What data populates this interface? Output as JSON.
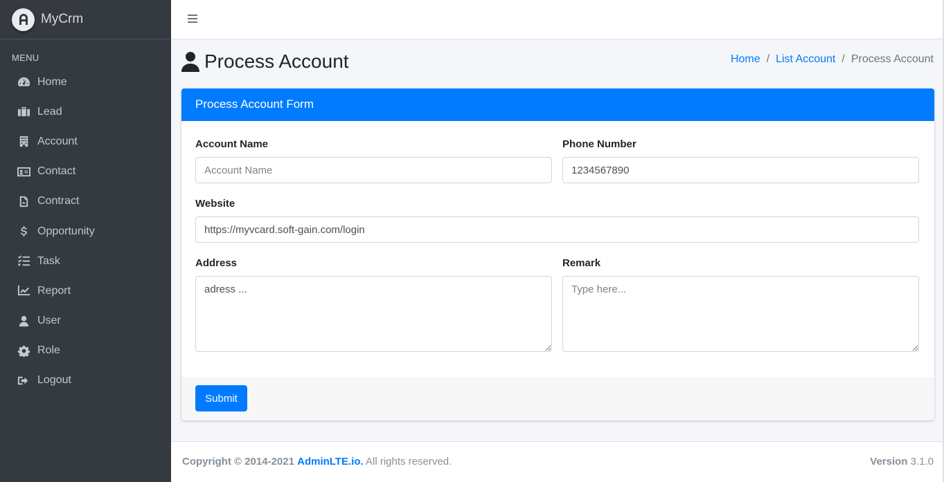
{
  "brand": {
    "name": "MyCrm",
    "logo_icon": "adminlte-logo-icon"
  },
  "sidebar": {
    "header": "MENU",
    "items": [
      {
        "label": "Home",
        "icon": "tachometer-icon"
      },
      {
        "label": "Lead",
        "icon": "briefcase-icon"
      },
      {
        "label": "Account",
        "icon": "building-icon"
      },
      {
        "label": "Contact",
        "icon": "address-card-icon"
      },
      {
        "label": "Contract",
        "icon": "file-contract-icon"
      },
      {
        "label": "Opportunity",
        "icon": "dollar-icon"
      },
      {
        "label": "Task",
        "icon": "tasks-icon"
      },
      {
        "label": "Report",
        "icon": "chart-line-icon"
      },
      {
        "label": "User",
        "icon": "user-icon"
      },
      {
        "label": "Role",
        "icon": "gear-icon"
      },
      {
        "label": "Logout",
        "icon": "sign-out-icon"
      }
    ]
  },
  "page": {
    "title": "Process Account",
    "breadcrumb": [
      "Home",
      "List Account",
      "Process Account"
    ]
  },
  "form": {
    "header": "Process Account Form",
    "account_name": {
      "label": "Account Name",
      "value": "",
      "placeholder": "Account Name"
    },
    "phone_number": {
      "label": "Phone Number",
      "value": "1234567890",
      "placeholder": ""
    },
    "website": {
      "label": "Website",
      "value": "https://myvcard.soft-gain.com/login",
      "placeholder": ""
    },
    "address": {
      "label": "Address",
      "value": "adress ...",
      "placeholder": ""
    },
    "remark": {
      "label": "Remark",
      "value": "",
      "placeholder": "Type here..."
    },
    "submit_label": "Submit"
  },
  "footer": {
    "copyright": "Copyright © 2014-2021",
    "link_text": "AdminLTE.io.",
    "rights": " All rights reserved.",
    "version_label": "Version",
    "version_value": " 3.1.0"
  },
  "colors": {
    "primary": "#007bff",
    "sidebar_bg": "#343a40",
    "content_bg": "#f4f6f9"
  }
}
